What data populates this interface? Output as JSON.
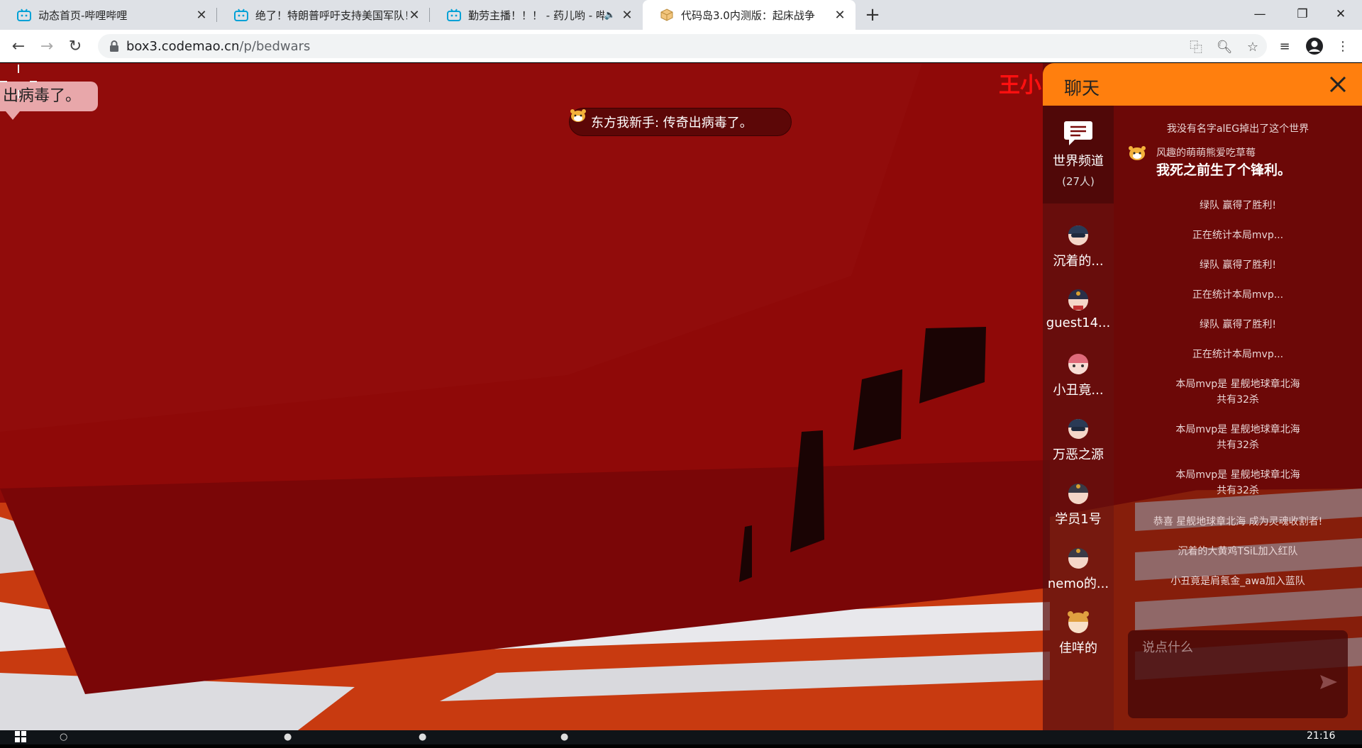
{
  "browser": {
    "tabs": [
      {
        "title": "动态首页-哔哩哔哩",
        "icon": "bilibili-icon"
      },
      {
        "title": "绝了！特朗普呼吁支持美国军队！",
        "icon": "bilibili-icon"
      },
      {
        "title": "勤劳主播！！！ - 药儿哟 - 哔",
        "icon": "bilibili-icon"
      },
      {
        "title": "代码岛3.0内测版：起床战争",
        "icon": "codemao-box-icon"
      }
    ],
    "url_host": "box3.codemao.cn",
    "url_path": "/p/bedwars"
  },
  "game": {
    "speech_bubble": "出病毒了。",
    "toast": "东方我新手: 传奇出病毒了。",
    "nameplate": "王小"
  },
  "chat": {
    "title": "聊天",
    "world_channel": "世界频道",
    "world_count": "(27人)",
    "players": [
      "沉着的...",
      "guest14...",
      "小丑竟...",
      "万恶之源",
      "学员1号",
      "nemo的...",
      "佳咩的"
    ],
    "messages_top": "我没有名字alEG掉出了这个世界",
    "user_msg": {
      "name": "风趣的萌萌熊爱吃草莓",
      "text": "我死之前生了个锋利。"
    },
    "system_messages": [
      "绿队 赢得了胜利!",
      "正在统计本局mvp...",
      "绿队 赢得了胜利!",
      "正在统计本局mvp...",
      "绿队 赢得了胜利!",
      "正在统计本局mvp...",
      "本局mvp是 星舰地球章北海",
      "共有32杀",
      "本局mvp是 星舰地球章北海",
      "共有32杀",
      "本局mvp是 星舰地球章北海",
      "共有32杀",
      "恭喜 星舰地球章北海 成为灵魂收割者!",
      "沉着的大黄鸡TSiL加入红队",
      "小丑竟是肩氪金_awa加入蓝队"
    ],
    "input_placeholder": "说点什么"
  },
  "taskbar": {
    "clock": "21:16"
  }
}
